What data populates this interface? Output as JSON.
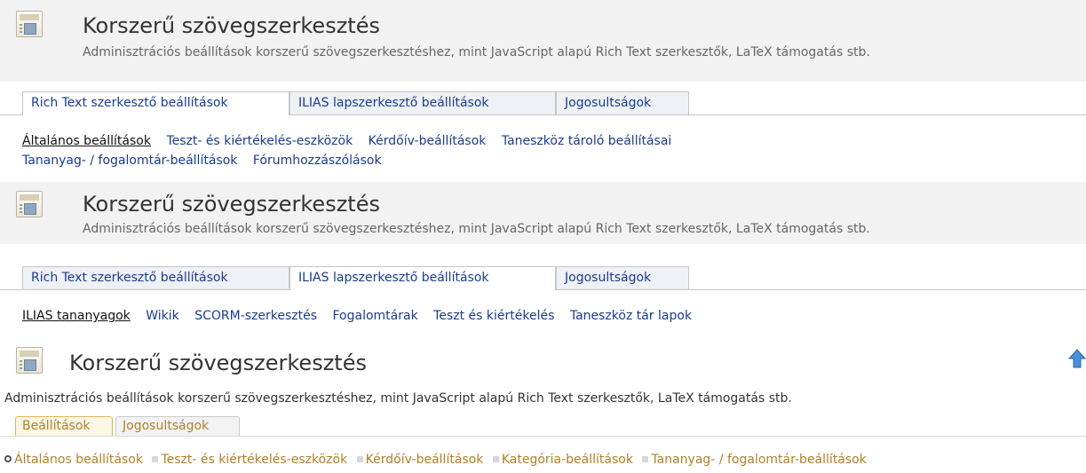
{
  "panel1": {
    "title": "Korszerű szövegszerkesztés",
    "description": "Adminisztrációs beállítások korszerű szövegszerkesztéshez, mint JavaScript alapú Rich Text szerkesztők, LaTeX támogatás stb.",
    "tabs": [
      {
        "label": "Rich Text szerkesztő beállítások",
        "active": true
      },
      {
        "label": "ILIAS lapszerkesztő beállítások",
        "active": false
      },
      {
        "label": "Jogosultságok",
        "active": false
      }
    ],
    "subtabs": [
      {
        "label": "Általános beállítások",
        "active": true
      },
      {
        "label": "Teszt- és kiértékelés-eszközök",
        "active": false
      },
      {
        "label": "Kérdőív-beállítások",
        "active": false
      },
      {
        "label": "Taneszköz tároló beállításai",
        "active": false
      },
      {
        "label": "Tananyag- / fogalomtár-beállítások",
        "active": false
      },
      {
        "label": "Fórumhozzászólások",
        "active": false
      }
    ]
  },
  "panel2": {
    "title": "Korszerű szövegszerkesztés",
    "description": "Adminisztrációs beállítások korszerű szövegszerkesztéshez, mint JavaScript alapú Rich Text szerkesztők, LaTeX támogatás stb.",
    "tabs": [
      {
        "label": "Rich Text szerkesztő beállítások",
        "active": false
      },
      {
        "label": "ILIAS lapszerkesztő beállítások",
        "active": true
      },
      {
        "label": "Jogosultságok",
        "active": false
      }
    ],
    "subtabs": [
      {
        "label": "ILIAS tananyagok",
        "active": true
      },
      {
        "label": "Wikik",
        "active": false
      },
      {
        "label": "SCORM-szerkesztés",
        "active": false
      },
      {
        "label": "Fogalomtárak",
        "active": false
      },
      {
        "label": "Teszt és kiértékelés",
        "active": false
      },
      {
        "label": "Taneszköz tár lapok",
        "active": false
      }
    ]
  },
  "panel3": {
    "title": "Korszerű szövegszerkesztés",
    "description": "Adminisztrációs beállítások korszerű szövegszerkesztéshez, mint JavaScript alapú Rich Text szerkesztők, LaTeX támogatás stb.",
    "tabs": [
      {
        "label": "Beállítások",
        "active": true
      },
      {
        "label": "Jogosultságok",
        "active": false
      }
    ],
    "subtabs": [
      {
        "label": "Általános beállítások",
        "active": true
      },
      {
        "label": "Teszt- és kiértékelés-eszközök",
        "active": false
      },
      {
        "label": "Kérdőív-beállítások",
        "active": false
      },
      {
        "label": "Kategória-beállítások",
        "active": false
      },
      {
        "label": "Tananyag- / fogalomtár-beállítások",
        "active": false
      }
    ],
    "up_icon": "up-arrow-icon"
  },
  "colors": {
    "link_blue": "#1a3c8f",
    "gold_link": "#b0812a",
    "header_bg": "#f2f2f2"
  }
}
